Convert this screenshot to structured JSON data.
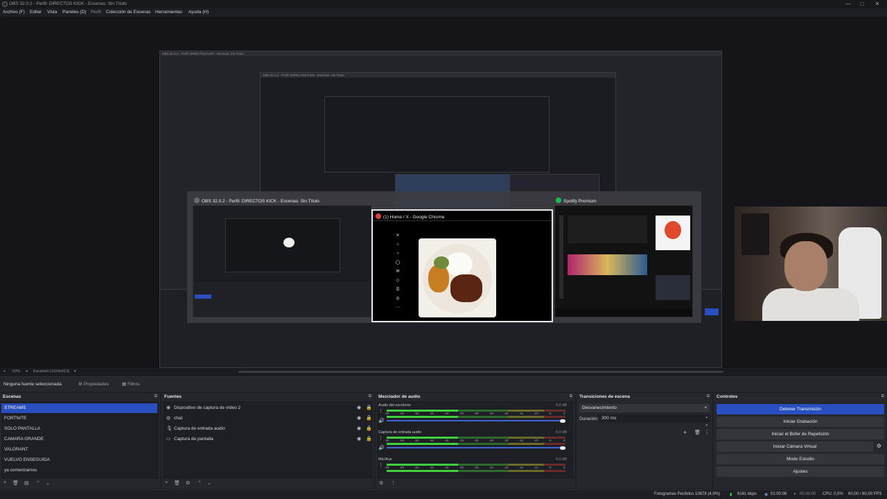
{
  "window": {
    "title": "OBS 32.0.2 - Perfil: DIRECTOS KICK - Escenas: Sin Título",
    "controls": [
      "—",
      "□",
      "✕"
    ]
  },
  "menu": [
    "Archivo (F)",
    "Editar",
    "Vista",
    "Paneles (D)",
    "Perfil",
    "Colección de Escenas",
    "Herramientas",
    "Ayuda (H)"
  ],
  "preview": {
    "nested_titles": [
      "OBS 32.0.2 - Perfil: DIRECTOS KICK - Escenas: Sin Título",
      "OBS 32.0.2 - Perfil: DIRECTOS KICK - Escenas: Sin Título"
    ],
    "switcher": [
      {
        "title": "OBS 32.0.2 - Perfil: DIRECTOS KICK - Escenas: Sin Título",
        "color": "#6b6c70"
      },
      {
        "title": "(1) Home / X - Google Chrome",
        "color": "#e34133"
      },
      {
        "title": "Spotify Premium",
        "color": "#1db954"
      }
    ],
    "zoom": "63%",
    "scale_label": "Escalado (1624x913)"
  },
  "source_toolbar": {
    "no_selection": "Ninguna fuente seleccionada",
    "properties": "Propiedades",
    "filters": "Filtros"
  },
  "scenes": {
    "title": "Escenas",
    "items": [
      "STREAMS",
      "FORTNITE",
      "SOLO PANTALLA",
      "CAMARA GRANDE",
      "VALORANT",
      "VUELVO ENSEGUIDA",
      "ya comenzamos"
    ],
    "selected_index": 0
  },
  "sources": {
    "title": "Fuentes",
    "items": [
      {
        "name": "Dispositivo de captura de vídeo 2",
        "icon": "camera-icon"
      },
      {
        "name": "chat",
        "icon": "globe-icon"
      },
      {
        "name": "Captura de entrada audio",
        "icon": "microphone-icon"
      },
      {
        "name": "Captura de pantalla",
        "icon": "monitor-icon"
      }
    ]
  },
  "mixer": {
    "title": "Mezclador de audio",
    "channels": [
      {
        "name": "Audio del escritorio",
        "db": "0.0 dB",
        "live": true,
        "volume": 1.0
      },
      {
        "name": "Captura de entrada audio",
        "db": "0.0 dB",
        "live": true,
        "volume": 1.0
      },
      {
        "name": "Mic/Aux",
        "db": "0.0 dB",
        "live": true,
        "volume": 1.0
      }
    ],
    "ticks": [
      "-60",
      "-55",
      "-50",
      "-45",
      "-40",
      "-35",
      "-30",
      "-25",
      "-20",
      "-15",
      "-10",
      "-5",
      "0"
    ]
  },
  "transitions": {
    "title": "Transiciones de escena",
    "selected": "Desvanecimiento",
    "duration_label": "Duración",
    "duration_value": "300 ms"
  },
  "controls": {
    "title": "Controles",
    "buttons": [
      "Detener Transmisión",
      "Iniciar Grabación",
      "Iniciar el Búfer de Repetición",
      "Iniciar Cámara Virtual",
      "Modo Estudio",
      "Ajustes"
    ]
  },
  "status": {
    "dropped": "Fotogramas Perdidos 10678 (4,9%)",
    "bitrate": "6161 kbps",
    "stream_time": "01:00:08",
    "rec_time": "00:00:00",
    "cpu": "CPU: 0,5%",
    "fps": "60,00 / 60,00 FPS"
  },
  "colors": {
    "accent": "#284ec0",
    "panel": "#26272d",
    "background": "#1e1f24"
  }
}
